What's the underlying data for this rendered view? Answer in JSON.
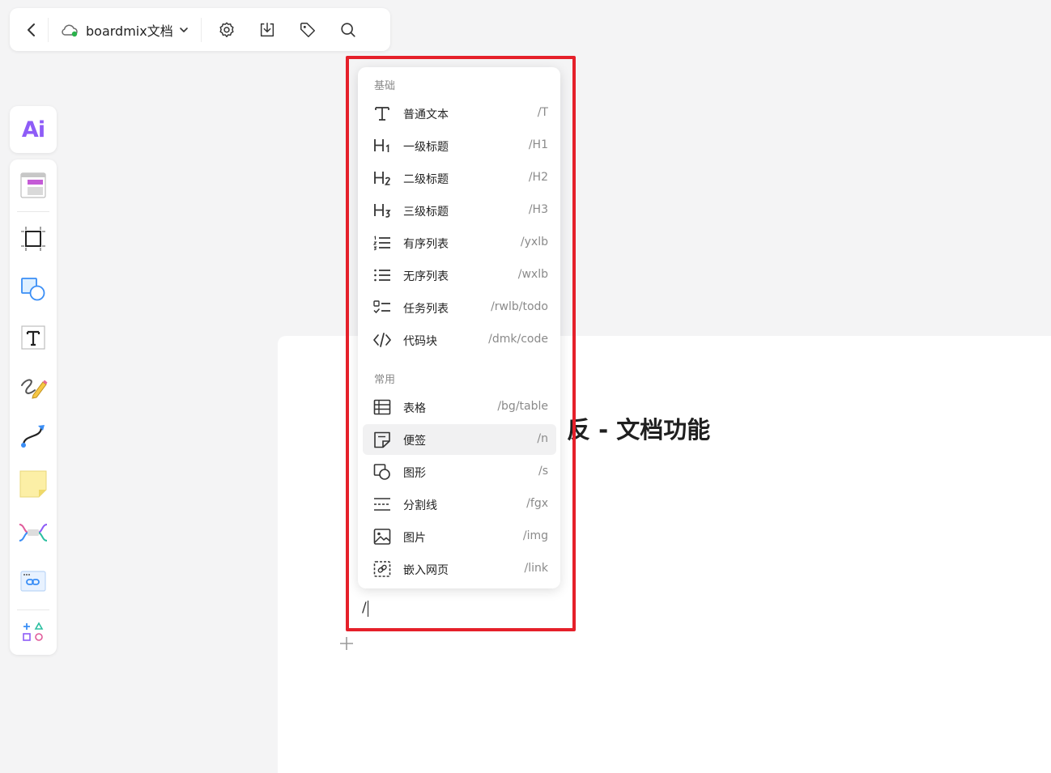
{
  "topbar": {
    "doc_name": "boardmix文档",
    "icons": [
      "back-chevron-icon",
      "cloud-sync-icon",
      "chevron-down-icon",
      "settings-gear-icon",
      "download-icon",
      "tag-icon",
      "search-icon"
    ]
  },
  "sidebar": {
    "ai_label": "Ai",
    "tools": [
      "template-icon",
      "frame-icon",
      "shape-icon",
      "text-icon",
      "pen-icon",
      "connector-icon",
      "sticky-note-icon",
      "mindmap-icon",
      "embed-link-icon",
      "more-apps-icon"
    ]
  },
  "document": {
    "title_fragment": "反 - 文档功能",
    "input_text": "/"
  },
  "slash_menu": {
    "sections": [
      {
        "label": "基础",
        "items": [
          {
            "icon": "text-t-icon",
            "label": "普通文本",
            "shortcut": "/T"
          },
          {
            "icon": "heading1-icon",
            "label": "一级标题",
            "shortcut": "/H1"
          },
          {
            "icon": "heading2-icon",
            "label": "二级标题",
            "shortcut": "/H2"
          },
          {
            "icon": "heading3-icon",
            "label": "三级标题",
            "shortcut": "/H3"
          },
          {
            "icon": "ordered-list-icon",
            "label": "有序列表",
            "shortcut": "/yxlb"
          },
          {
            "icon": "unordered-list-icon",
            "label": "无序列表",
            "shortcut": "/wxlb"
          },
          {
            "icon": "task-list-icon",
            "label": "任务列表",
            "shortcut": "/rwlb/todo"
          },
          {
            "icon": "code-block-icon",
            "label": "代码块",
            "shortcut": "/dmk/code"
          }
        ]
      },
      {
        "label": "常用",
        "items": [
          {
            "icon": "table-icon",
            "label": "表格",
            "shortcut": "/bg/table"
          },
          {
            "icon": "sticky-note-icon",
            "label": "便签",
            "shortcut": "/n"
          },
          {
            "icon": "shape-icon",
            "label": "图形",
            "shortcut": "/s"
          },
          {
            "icon": "divider-icon",
            "label": "分割线",
            "shortcut": "/fgx"
          },
          {
            "icon": "image-icon",
            "label": "图片",
            "shortcut": "/img"
          },
          {
            "icon": "embed-webpage-icon",
            "label": "嵌入网页",
            "shortcut": "/link"
          }
        ]
      }
    ]
  },
  "colors": {
    "highlight_border": "#e5202a",
    "ai_purple": "#8e5cf7",
    "sync_green": "#2bb24c",
    "accent_blue": "#3a8ef6"
  }
}
